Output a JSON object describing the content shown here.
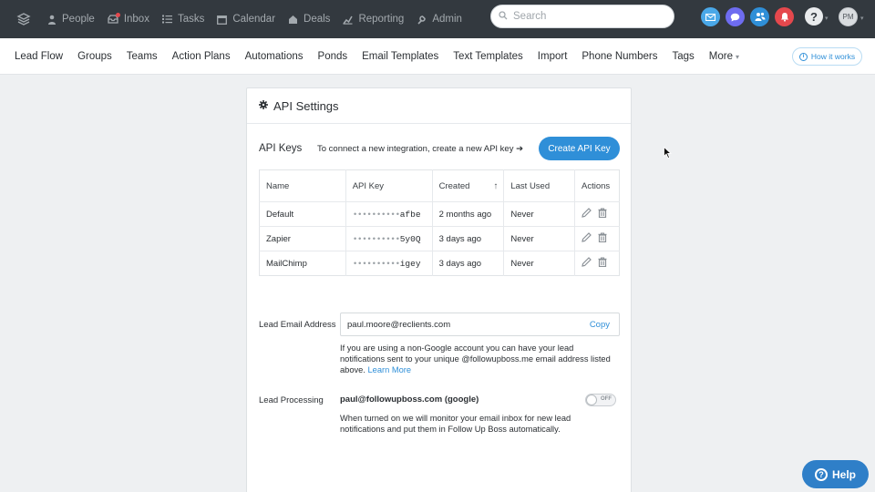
{
  "topnav": {
    "items": [
      {
        "label": "People",
        "icon": "people-icon"
      },
      {
        "label": "Inbox",
        "icon": "inbox-icon"
      },
      {
        "label": "Tasks",
        "icon": "tasks-icon"
      },
      {
        "label": "Calendar",
        "icon": "calendar-icon"
      },
      {
        "label": "Deals",
        "icon": "deals-icon"
      },
      {
        "label": "Reporting",
        "icon": "reporting-icon"
      },
      {
        "label": "Admin",
        "icon": "admin-icon"
      }
    ],
    "search_placeholder": "Search",
    "avatar_initials": "PM",
    "help_glyph": "?",
    "colors": {
      "bar": "#33393f",
      "email": "#4aa8e8",
      "chat": "#6e6cf0",
      "users": "#2f8fd8",
      "alert": "#e5484d"
    }
  },
  "subnav": {
    "items": [
      "Lead Flow",
      "Groups",
      "Teams",
      "Action Plans",
      "Automations",
      "Ponds",
      "Email Templates",
      "Text Templates",
      "Import",
      "Phone Numbers",
      "Tags",
      "More"
    ],
    "how_it_works": "How it works"
  },
  "card": {
    "title": "API Settings",
    "api_keys_label": "API Keys",
    "api_keys_hint": "To connect a new integration, create a new API key ➔",
    "create_button": "Create API Key",
    "table": {
      "headers": [
        "Name",
        "API Key",
        "Created",
        "Last Used",
        "Actions"
      ],
      "rows": [
        {
          "name": "Default",
          "key_mask": "••••••••••",
          "key_suffix": "afbe",
          "created": "2 months ago",
          "last_used": "Never"
        },
        {
          "name": "Zapier",
          "key_mask": "••••••••••",
          "key_suffix": "5y0Q",
          "created": "3 days ago",
          "last_used": "Never"
        },
        {
          "name": "MailChimp",
          "key_mask": "••••••••••",
          "key_suffix": "igey",
          "created": "3 days ago",
          "last_used": "Never"
        }
      ]
    },
    "lead_email": {
      "label": "Lead Email Address",
      "value": "paul.moore@reclients.com",
      "copy": "Copy",
      "help": "If you are using a non-Google account you can have your lead notifications sent to your unique @followupboss.me email address listed above.",
      "learn_more": "Learn More"
    },
    "lead_processing": {
      "label": "Lead Processing",
      "account": "paul@followupboss.com (google)",
      "toggle_state": "OFF",
      "help": "When turned on we will monitor your email inbox for new lead notifications and put them in Follow Up Boss automatically."
    }
  },
  "help_fab": "Help"
}
